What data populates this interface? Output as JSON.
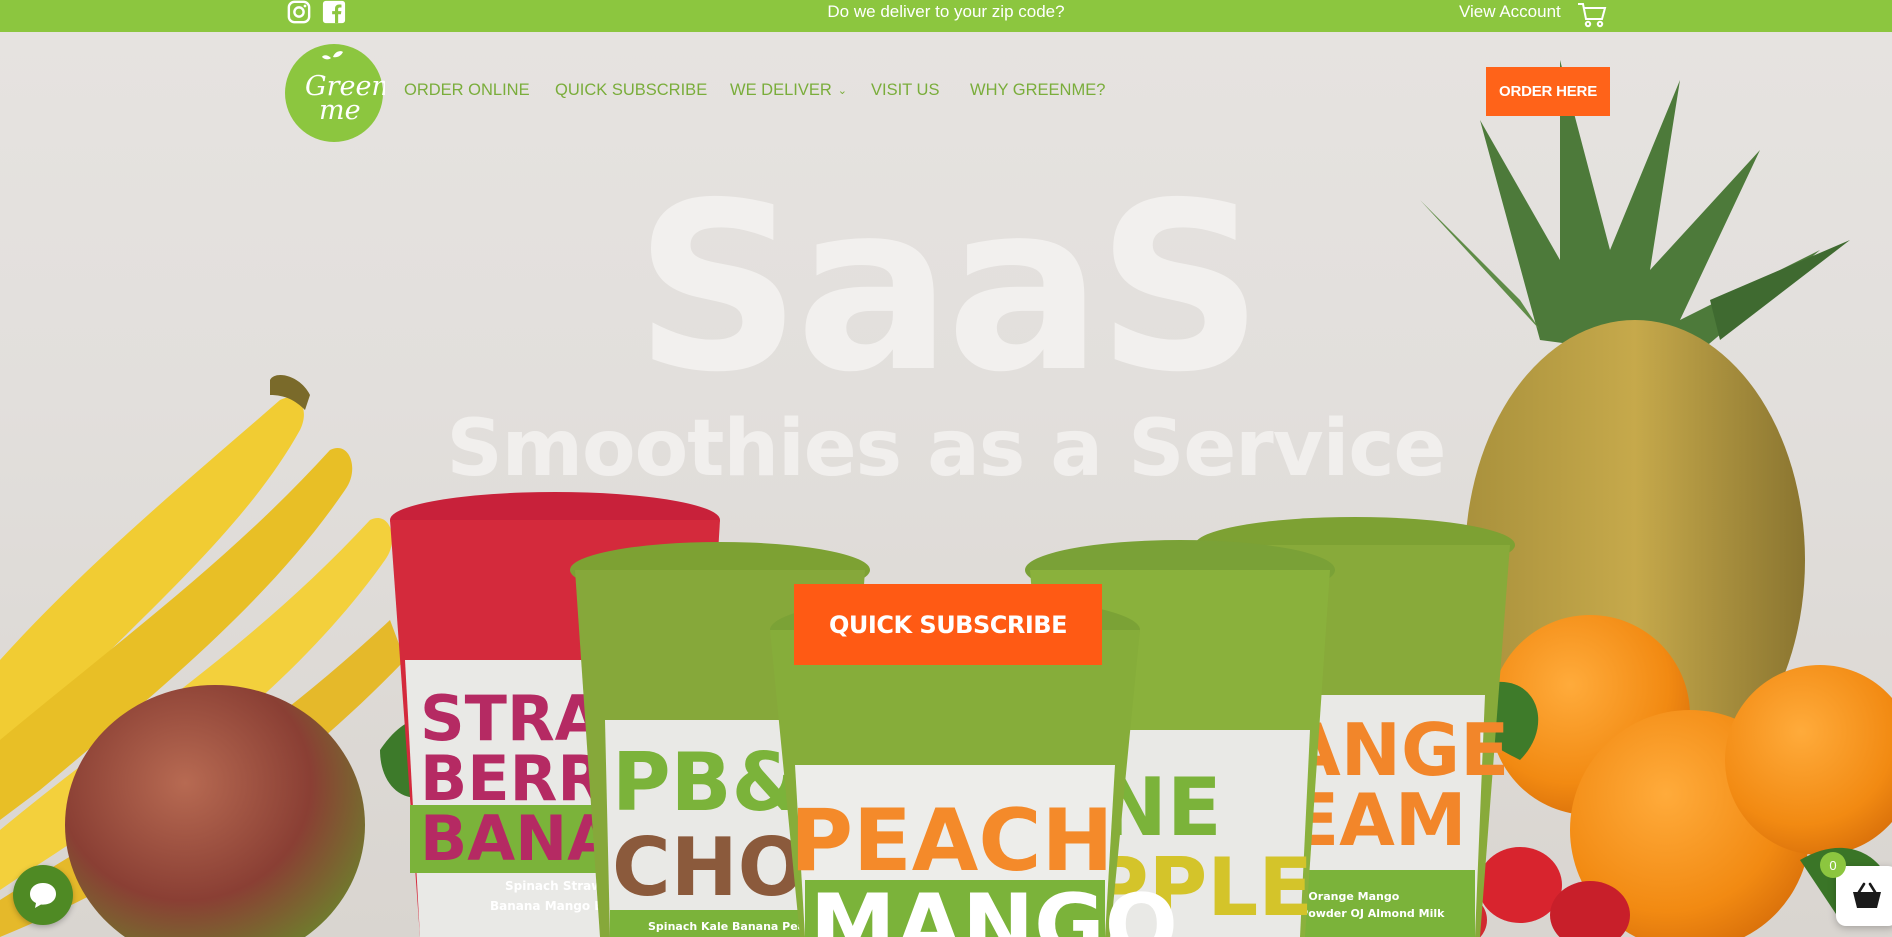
{
  "colors": {
    "brand_green": "#8cc63f",
    "nav_green": "#7aad3b",
    "cta_orange": "#ff6319",
    "hero_text": "#f2f0ee"
  },
  "topbar": {
    "social": [
      {
        "icon": "instagram-icon"
      },
      {
        "icon": "facebook-icon"
      }
    ],
    "zip_prompt": "Do we deliver to your zip code?",
    "account_link": "View Account",
    "cart_icon": "cart-icon"
  },
  "header": {
    "logo_text_line1": "Green",
    "logo_text_line2": "me",
    "nav": [
      {
        "label": "ORDER ONLINE"
      },
      {
        "label": "QUICK SUBSCRIBE"
      },
      {
        "label": "WE DELIVER",
        "has_dropdown": true
      },
      {
        "label": "VISIT US"
      },
      {
        "label": "WHY GREENME?"
      }
    ],
    "order_button": "ORDER HERE"
  },
  "hero": {
    "title": "SaaS",
    "subtitle": "Smoothies as a Service",
    "cta": "QUICK SUBSCRIBE",
    "cups": [
      {
        "label": [
          "STRAW",
          "BERRY",
          "BANAN"
        ],
        "ingredients": [
          "Spinach  Strawberry",
          "Banana  Mango  Beet"
        ]
      },
      {
        "label": [
          "PB&",
          "CHO"
        ],
        "ingredients": [
          "Spinach  Kale  Banana  Pea"
        ]
      },
      {
        "label": [
          "PEACH",
          "MANGO"
        ],
        "ingredients": []
      },
      {
        "label": [
          "NE",
          "PPLE"
        ],
        "ingredients": []
      },
      {
        "label": [
          "ANGE",
          "EAM"
        ],
        "ingredients": [
          "nach  Orange  Mango",
          "tein Powder  OJ  Almond Milk"
        ]
      }
    ]
  },
  "widgets": {
    "chat_icon": "chat-bubble-icon",
    "basket_icon": "basket-icon",
    "basket_count": "0"
  }
}
